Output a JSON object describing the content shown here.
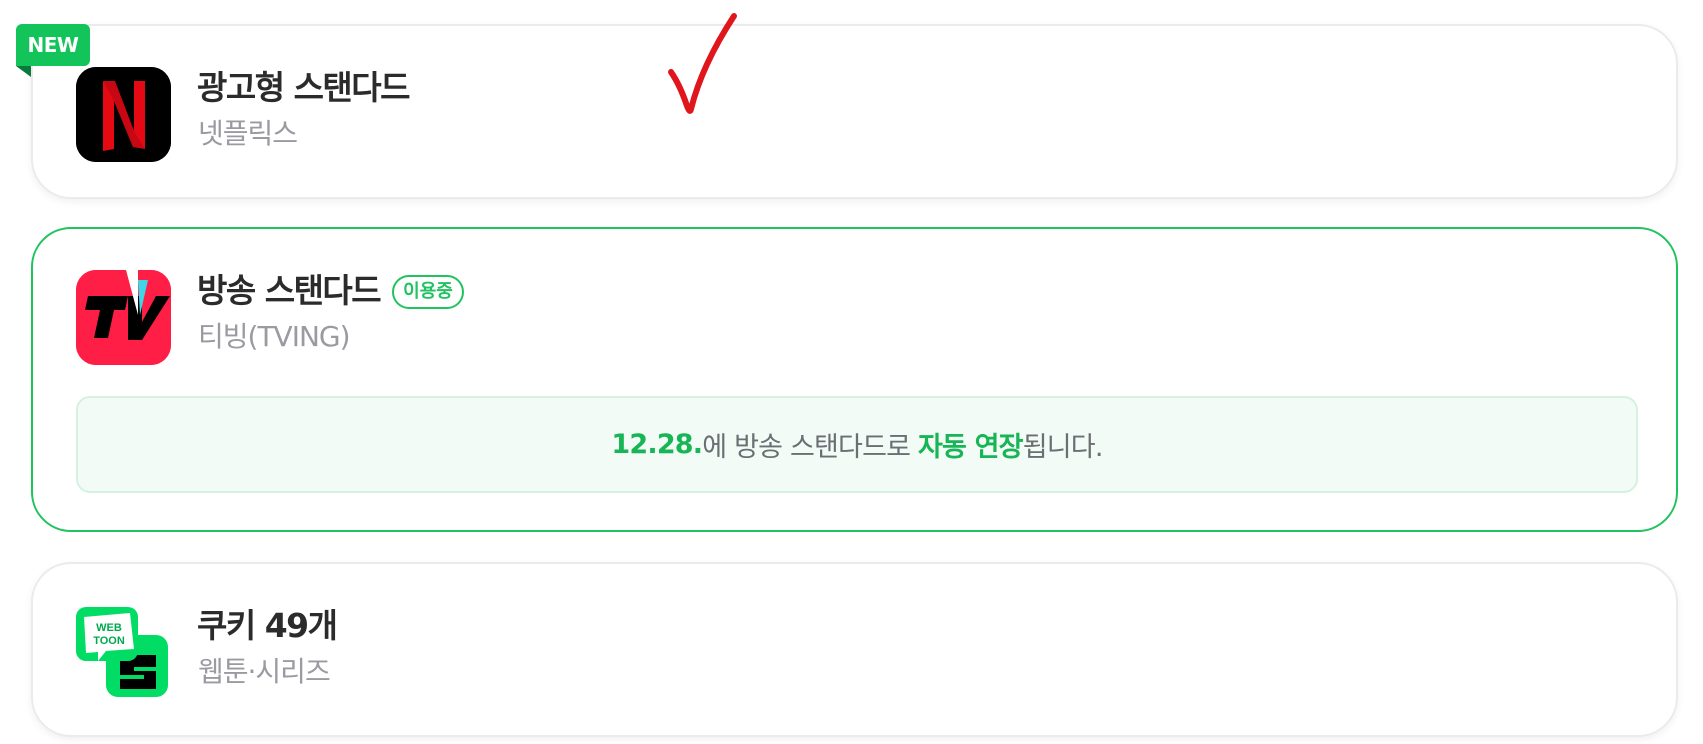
{
  "cards": [
    {
      "title": "광고형 스탠다드",
      "subtitle": "넷플릭스",
      "tag": "NEW",
      "logo_icon": "netflix-logo-icon"
    },
    {
      "title": "방송 스탠다드",
      "subtitle": "티빙(TVING)",
      "status_badge": "이용중",
      "logo_icon": "tving-logo-icon",
      "notice": {
        "date": "12.28.",
        "middle": "에 방송 스탠다드로 ",
        "highlight": "자동 연장",
        "end": "됩니다."
      }
    },
    {
      "title": "쿠키 49개",
      "subtitle": "웹툰·시리즈",
      "logo_icon": "webtoon-series-logo-icon",
      "logo_text": "WEB TOON"
    }
  ],
  "colors": {
    "accent": "#20c35f",
    "new_tag": "#13c45a",
    "notice_bg": "#f2fbf5",
    "checkmark": "#e0161d"
  },
  "annotation_icon": "red-checkmark-icon"
}
